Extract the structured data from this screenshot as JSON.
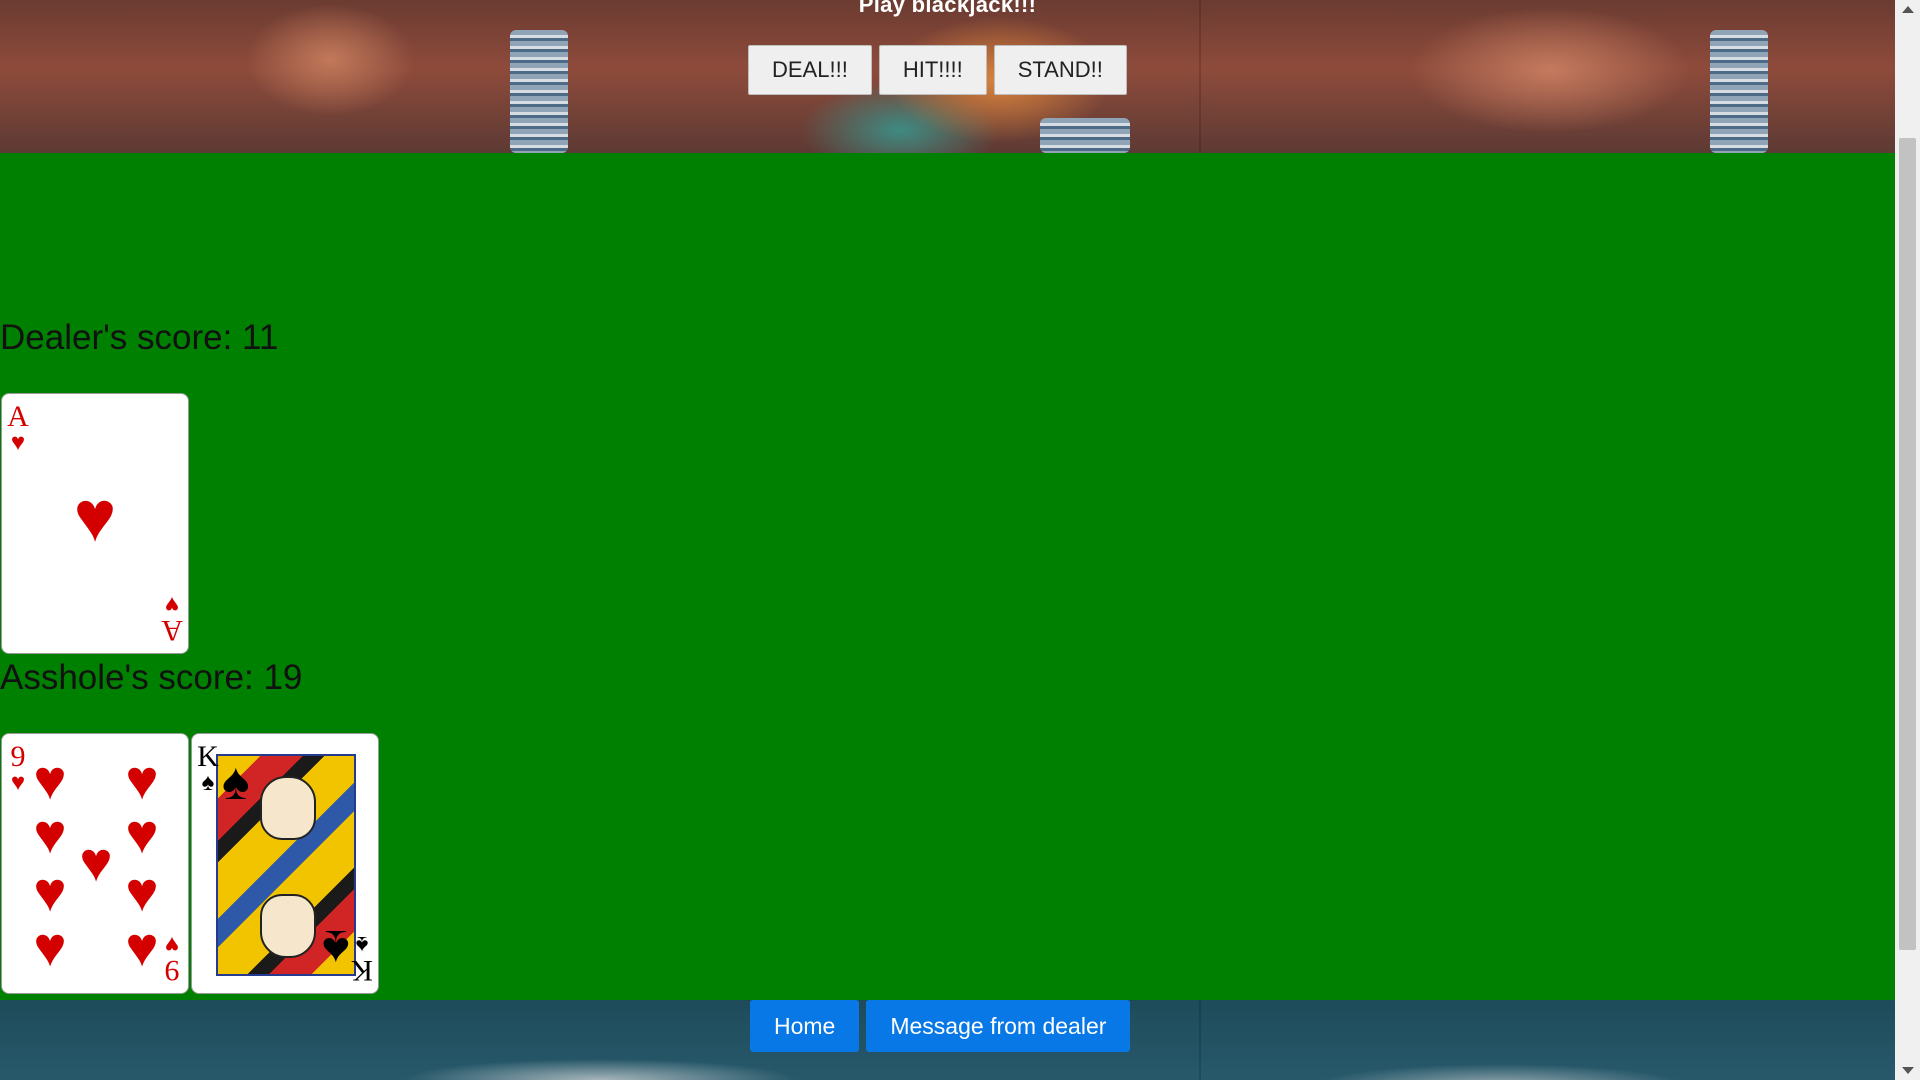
{
  "header": {
    "title": "Play blackjack!!!",
    "buttons": {
      "deal": "DEAL!!!",
      "hit": "HIT!!!!",
      "stand": "STAND!!"
    }
  },
  "dealer": {
    "score_text": "Dealer's score: 11",
    "cards": [
      {
        "rank": "A",
        "suit": "♥",
        "suit_name": "hearts",
        "color": "#d40000"
      }
    ]
  },
  "player": {
    "score_text": "Asshole's score: 19",
    "cards": [
      {
        "rank": "9",
        "suit": "♥",
        "suit_name": "hearts",
        "color": "#d40000"
      },
      {
        "rank": "K",
        "suit": "♠",
        "suit_name": "spades",
        "color": "#000000"
      }
    ]
  },
  "footer": {
    "buttons": {
      "home": "Home",
      "message": "Message from dealer"
    }
  },
  "colors": {
    "table_green": "#008000",
    "nav_blue": "#0878e6"
  }
}
